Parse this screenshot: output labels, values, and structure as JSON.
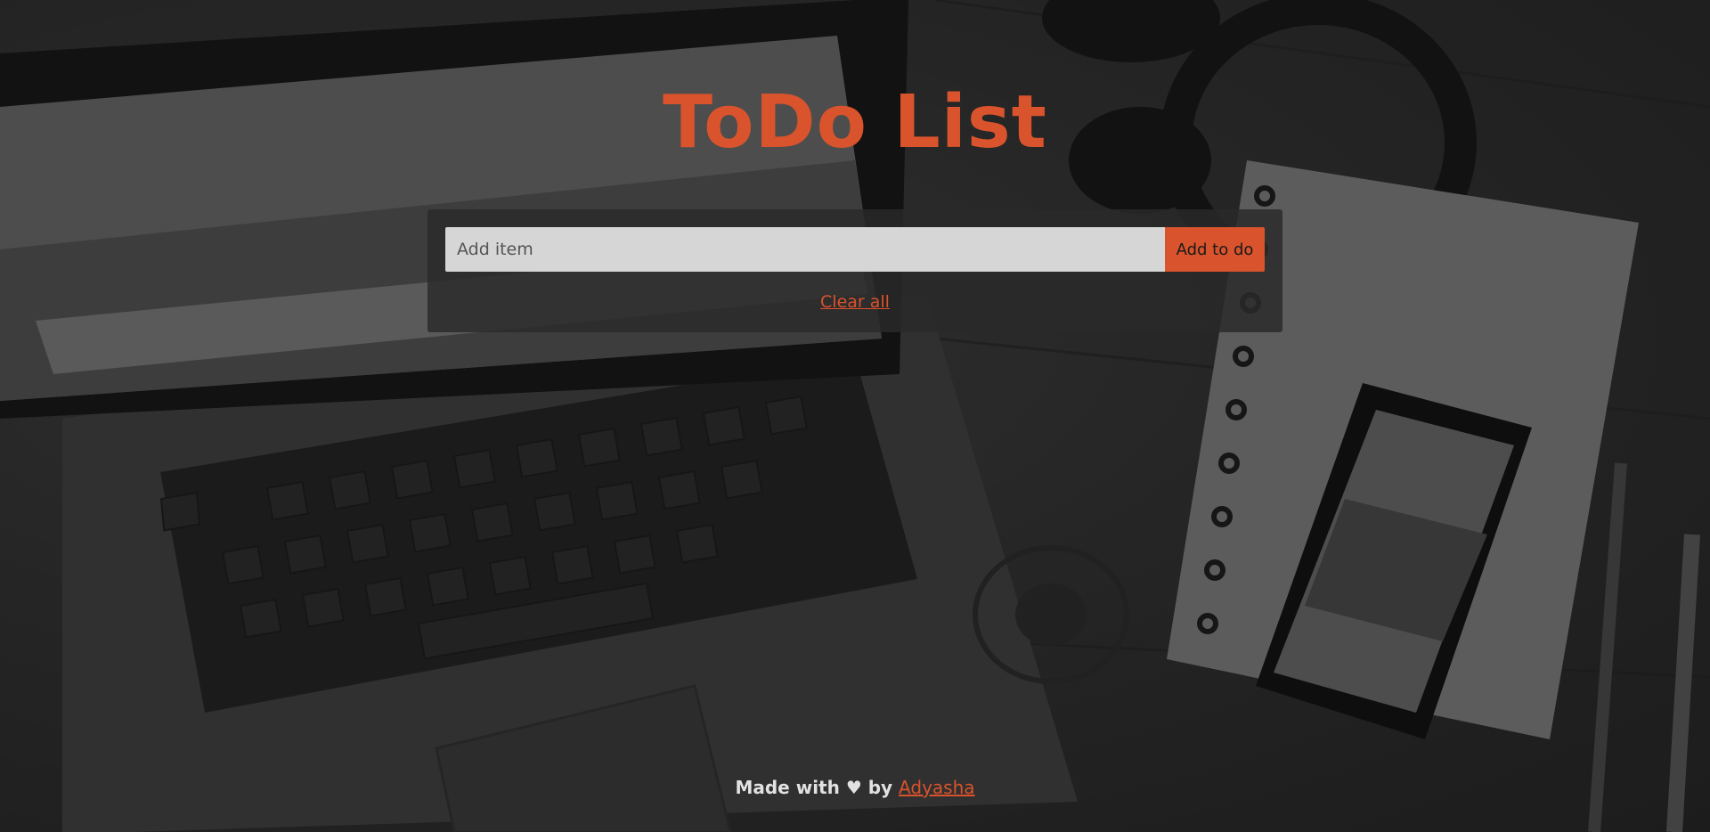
{
  "app": {
    "title": "ToDo List",
    "accent_color": "#d9532c"
  },
  "form": {
    "input_placeholder": "Add item",
    "input_value": "",
    "add_label": "Add to do"
  },
  "actions": {
    "clear_all_label": "Clear all"
  },
  "footer": {
    "prefix": "Made with",
    "heart": "♥",
    "by": "by",
    "author": "Adyasha"
  },
  "background": {
    "description_icon": "desk-laptop-phone-notebook-photo",
    "tone": "grayscale"
  }
}
